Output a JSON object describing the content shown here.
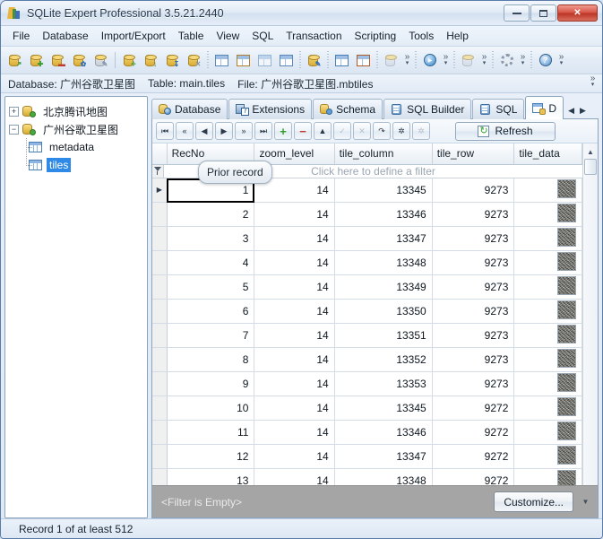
{
  "window": {
    "title": "SQLite Expert Professional 3.5.21.2440",
    "app_icon": "sqlite-expert-logo",
    "buttons": {
      "minimize": "minimize",
      "restore": "restore",
      "close": "close"
    }
  },
  "menu": [
    {
      "label": "File",
      "accel": "F"
    },
    {
      "label": "Database",
      "accel": "D"
    },
    {
      "label": "Import/Export",
      "accel": "I"
    },
    {
      "label": "Table",
      "accel": "T"
    },
    {
      "label": "View",
      "accel": "V"
    },
    {
      "label": "SQL",
      "accel": "S"
    },
    {
      "label": "Transaction",
      "accel": "r"
    },
    {
      "label": "Scripting",
      "accel": "c"
    },
    {
      "label": "Tools",
      "accel": "o"
    },
    {
      "label": "Help",
      "accel": "H"
    }
  ],
  "toolbar": {
    "groups": [
      {
        "icons": [
          "database-open-icon",
          "database-add-icon",
          "database-close-icon",
          "database-properties-icon",
          "database-search-icon"
        ]
      },
      {
        "icons": [
          "table-new-icon",
          "table-import-icon",
          "table-export-icon",
          "table-delete-icon"
        ]
      },
      {
        "icons": [
          "grid-view-icon",
          "text-view-icon",
          "blob-view-icon",
          "design-view-icon"
        ]
      },
      {
        "icons": [
          "data-edit-icon"
        ]
      },
      {
        "icons": [
          "compare-icon",
          "csv-export-icon"
        ]
      },
      {
        "icons": [
          "script-run-icon"
        ],
        "overflow": "chevron-double-right"
      },
      {
        "icons": [
          "execute-icon"
        ],
        "overflow": "chevron-double-right"
      },
      {
        "icons": [
          "script-icon"
        ],
        "overflow": "chevron-double-right"
      },
      {
        "icons": [
          "tools-gear-icon"
        ],
        "overflow": "chevron-double-right"
      },
      {
        "icons": [
          "help-icon"
        ],
        "overflow": "chevron-double-right"
      }
    ],
    "overflow_glyph": "»",
    "caret_glyph": "▾"
  },
  "infobar": {
    "database_label": "Database: 广州谷歌卫星图",
    "table_label": "Table: main.tiles",
    "file_label": "File: 广州谷歌卫星图.mbtiles",
    "overflow_glyph": "»"
  },
  "tree": {
    "nodes": [
      {
        "expander": "+",
        "label": "北京腾讯地图",
        "icon": "database-icon",
        "selected": false
      },
      {
        "expander": "−",
        "label": "广州谷歌卫星图",
        "icon": "database-icon",
        "selected": false
      },
      {
        "expander": "",
        "label": "metadata",
        "icon": "table-icon",
        "selected": false,
        "child": true
      },
      {
        "expander": "",
        "label": "tiles",
        "icon": "table-icon",
        "selected": true,
        "child": true
      }
    ]
  },
  "tabs": {
    "items": [
      {
        "label": "Database",
        "icon": "database-tab-icon",
        "active": false
      },
      {
        "label": "Extensions",
        "icon": "extensions-tab-icon",
        "active": false
      },
      {
        "label": "Schema",
        "icon": "schema-tab-icon",
        "active": false
      },
      {
        "label": "SQL Builder",
        "icon": "sql-builder-tab-icon",
        "active": false
      },
      {
        "label": "SQL",
        "icon": "sql-tab-icon",
        "active": false
      },
      {
        "label": "D",
        "icon": "data-tab-icon",
        "active": true
      }
    ],
    "scroll_left": "◀",
    "scroll_right": "▶"
  },
  "nav_toolbar": {
    "buttons": [
      {
        "name": "first-record-button",
        "glyph": "⏮",
        "state": "enabled"
      },
      {
        "name": "prior-page-button",
        "glyph": "«",
        "state": "enabled"
      },
      {
        "name": "prior-record-button",
        "glyph": "◀",
        "state": "enabled"
      },
      {
        "name": "next-record-button",
        "glyph": "▶",
        "state": "enabled"
      },
      {
        "name": "next-page-button",
        "glyph": "»",
        "state": "enabled"
      },
      {
        "name": "last-record-button",
        "glyph": "⏭",
        "state": "enabled"
      },
      {
        "name": "insert-record-button",
        "glyph": "+",
        "state": "enabled"
      },
      {
        "name": "delete-record-button",
        "glyph": "−",
        "state": "enabled"
      },
      {
        "name": "edit-record-button",
        "glyph": "▲",
        "state": "enabled"
      },
      {
        "name": "post-edit-button",
        "glyph": "✓",
        "state": "disabled"
      },
      {
        "name": "cancel-edit-button",
        "glyph": "✕",
        "state": "disabled"
      },
      {
        "name": "refresh-record-button",
        "glyph": "↷",
        "state": "enabled"
      },
      {
        "name": "set-null-button",
        "glyph": "✲",
        "state": "enabled"
      },
      {
        "name": "clear-null-button",
        "glyph": "✲",
        "state": "disabled"
      }
    ],
    "refresh_label": "Refresh",
    "refresh_icon": "refresh-icon"
  },
  "tooltip": {
    "text": "Prior record"
  },
  "grid": {
    "columns": [
      "RecNo",
      "zoom_level",
      "tile_column",
      "tile_row",
      "tile_data"
    ],
    "filter_placeholder": "Click here to define a filter",
    "filter_icon": "funnel-icon",
    "current_row_index": 0,
    "rows": [
      {
        "RecNo": "1",
        "zoom_level": "14",
        "tile_column": "13345",
        "tile_row": "9273",
        "tile_data": "blob-thumbnail"
      },
      {
        "RecNo": "2",
        "zoom_level": "14",
        "tile_column": "13346",
        "tile_row": "9273",
        "tile_data": "blob-thumbnail"
      },
      {
        "RecNo": "3",
        "zoom_level": "14",
        "tile_column": "13347",
        "tile_row": "9273",
        "tile_data": "blob-thumbnail"
      },
      {
        "RecNo": "4",
        "zoom_level": "14",
        "tile_column": "13348",
        "tile_row": "9273",
        "tile_data": "blob-thumbnail"
      },
      {
        "RecNo": "5",
        "zoom_level": "14",
        "tile_column": "13349",
        "tile_row": "9273",
        "tile_data": "blob-thumbnail"
      },
      {
        "RecNo": "6",
        "zoom_level": "14",
        "tile_column": "13350",
        "tile_row": "9273",
        "tile_data": "blob-thumbnail"
      },
      {
        "RecNo": "7",
        "zoom_level": "14",
        "tile_column": "13351",
        "tile_row": "9273",
        "tile_data": "blob-thumbnail"
      },
      {
        "RecNo": "8",
        "zoom_level": "14",
        "tile_column": "13352",
        "tile_row": "9273",
        "tile_data": "blob-thumbnail"
      },
      {
        "RecNo": "9",
        "zoom_level": "14",
        "tile_column": "13353",
        "tile_row": "9273",
        "tile_data": "blob-thumbnail"
      },
      {
        "RecNo": "10",
        "zoom_level": "14",
        "tile_column": "13345",
        "tile_row": "9272",
        "tile_data": "blob-thumbnail"
      },
      {
        "RecNo": "11",
        "zoom_level": "14",
        "tile_column": "13346",
        "tile_row": "9272",
        "tile_data": "blob-thumbnail"
      },
      {
        "RecNo": "12",
        "zoom_level": "14",
        "tile_column": "13347",
        "tile_row": "9272",
        "tile_data": "blob-thumbnail"
      },
      {
        "RecNo": "13",
        "zoom_level": "14",
        "tile_column": "13348",
        "tile_row": "9272",
        "tile_data": "blob-thumbnail"
      }
    ],
    "row_indicator_glyph": "▶",
    "scroll_up_glyph": "▲"
  },
  "filterbar": {
    "text": "<Filter is Empty>",
    "customize_label": "Customize...",
    "scroll_glyph": "▼"
  },
  "statusbar": {
    "text": "Record 1 of at least 512"
  },
  "colors": {
    "selection_blue": "#2e8ae6",
    "close_red": "#bc3526",
    "filterbar_gray": "#a5a5a5",
    "add_green": "#2f9e2a",
    "delete_red": "#c0392b"
  }
}
